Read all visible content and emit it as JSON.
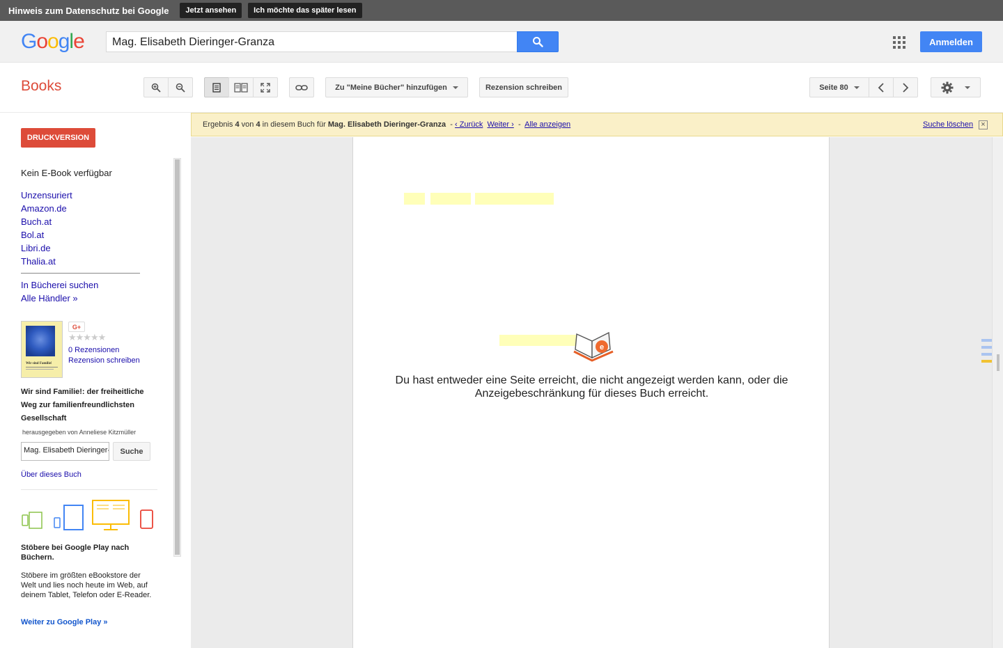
{
  "privacy": {
    "title": "Hinweis zum Datenschutz bei Google",
    "view_btn": "Jetzt ansehen",
    "later_btn": "Ich möchte das später lesen"
  },
  "header": {
    "logo_letters": [
      "G",
      "o",
      "o",
      "g",
      "l",
      "e"
    ],
    "search_value": "Mag. Elisabeth Dieringer-Granza",
    "signin_label": "Anmelden"
  },
  "toolbar": {
    "section_title": "Books",
    "add_to_library": "Zu \"Meine Bücher\" hinzufügen",
    "write_review": "Rezension schreiben",
    "page_label": "Seite 80"
  },
  "sidebar": {
    "print_btn": "DRUCKVERSION",
    "no_ebook": "Kein E-Book verfügbar",
    "stores": [
      "Unzensuriert",
      "Amazon.de",
      "Buch.at",
      "Bol.at",
      "Libri.de",
      "Thalia.at"
    ],
    "library_links": [
      "In Bücherei suchen",
      "Alle Händler »"
    ],
    "gplus": "G+",
    "stars": "★★★★★",
    "review_count": "0 Rezensionen",
    "review_write": "Rezension schreiben",
    "cover_text": "Wir sind Familie!",
    "book_title": "Wir sind Familie!: der freiheitliche Weg zur familienfreundlichsten Gesellschaft",
    "editor": "herausgegeben von Anneliese Kitzmüller",
    "search_value": "Mag. Elisabeth Dieringer-",
    "search_btn": "Suche",
    "about": "Über dieses Buch",
    "play_heading": "Stöbere bei Google Play nach Büchern.",
    "play_text": "Stöbere im größten eBookstore der Welt und lies noch heute im Web, auf deinem Tablet, Telefon oder E-Reader.",
    "play_link": "Weiter zu Google Play »"
  },
  "result": {
    "prefix": "Ergebnis",
    "current": "4",
    "of": "von",
    "total": "4",
    "in_book": "in diesem Buch für",
    "query": "Mag. Elisabeth Dieringer-Granza",
    "sep1": "-",
    "back": "‹ Zurück",
    "next": "Weiter ›",
    "sep2": "-",
    "show_all": "Alle anzeigen",
    "clear": "Suche löschen",
    "close": "×"
  },
  "viewer": {
    "message": "Du hast entweder eine Seite erreicht, die nicht angezeigt werden kann, oder die Anzeigebeschränkung für dieses Buch erreicht."
  },
  "colors": {
    "books_red": "#dd4b39",
    "google_blue": "#4285f4",
    "highlight": "#ffffb9",
    "banner": "#faf0c8"
  }
}
